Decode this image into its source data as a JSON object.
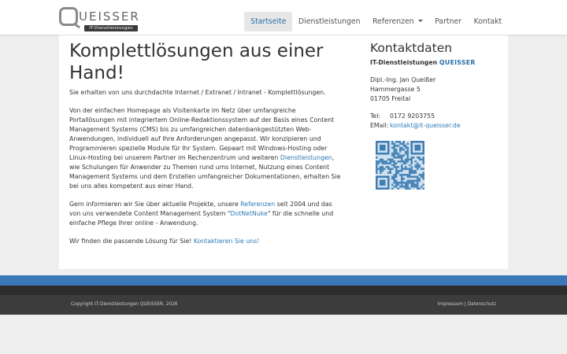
{
  "header": {
    "logo_text": "UEISSER",
    "logo_sub": "IT-Dienstleistungen",
    "nav": [
      {
        "label": "Startseite",
        "active": true
      },
      {
        "label": "Dienstleistungen"
      },
      {
        "label": "Referenzen",
        "dropdown": true
      },
      {
        "label": "Partner"
      },
      {
        "label": "Kontakt"
      }
    ]
  },
  "main": {
    "title": "Komplettlösungen aus einer Hand!",
    "intro": "Sie erhalten von uns durchdachte Internet / Extranet / Intranet - Komplettlösungen.",
    "para2_before": "Von der einfachen Homepage als Visitenkarte im Netz über umfangreiche Portallösungen mit integriertem Online-Redaktionssystem auf der Basis eines Content Management Systems (CMS) bis zu umfangreichen datenbankgestützten Web-Anwendungen, individuell auf Ihre Anforderungen angepasst. Wir konzipieren und Programmieren spezielle Module für Ihr System. Gepaart mit Windows-Hosting oder Linux-Hosting bei unserem Partner im Rechenzentrum und weiteren ",
    "para2_link": "Dienstleistungen",
    "para2_after": ", wie Schulungen für Anwender zu Themen rund ums Internet, Nutzung eines Content Management Systems und dem Erstellen umfangreicher Dokumentationen, erhalten Sie bei uns alles kompetent aus einer Hand.",
    "para3_before": "Gern informieren wir Sie über aktuelle Projekte, unsere ",
    "para3_link1": "Referenzen",
    "para3_mid": " seit 2004 und das von uns verwendete Content Management System \"",
    "para3_link2": "DotNetNuke",
    "para3_after": "\" für die schnelle und einfache Pflege Ihrer online - Anwendung.",
    "para4_before": "Wir finden die passende Lösung für Sie! ",
    "para4_link": "Kontaktieren Sie uns!"
  },
  "sidebar": {
    "title": "Kontaktdaten",
    "company_prefix": "IT-Dienstleistungen ",
    "company_brand": "QUEISSER",
    "address_name": "Dipl.-Ing. Jan Queißer",
    "address_street": "Hammergasse 5",
    "address_city": "01705 Freital",
    "tel_label": "Tel:",
    "tel_value": "0172 9203755",
    "email_label": "EMail:",
    "email_value": "kontakt@it-queisser.de"
  },
  "footer": {
    "copyright": "Copyright IT-Dienstleistungen QUEISSER, 2026",
    "impressum": "Impressum",
    "separator": " | ",
    "datenschutz": "Datenschutz"
  },
  "colors": {
    "accent": "#2a6fa8",
    "link": "#2a7ab8",
    "footer_blue": "#3a78b8",
    "footer_dark": "#3c3c3c"
  }
}
